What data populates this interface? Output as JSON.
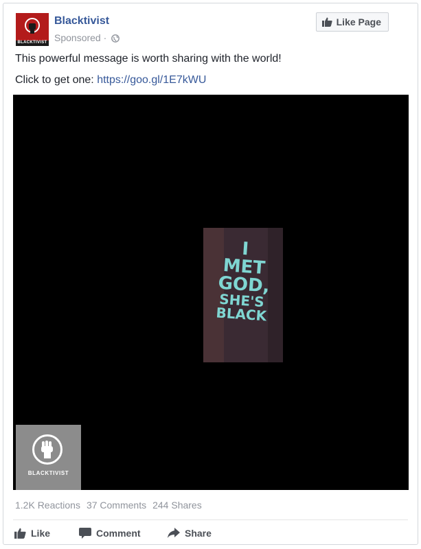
{
  "header": {
    "page_name": "Blacktivist",
    "sponsored": "Sponsored ·",
    "avatar_label": "BLACKTIVIST",
    "like_page_label": "Like Page"
  },
  "post": {
    "message": "This powerful message is worth sharing with the world!",
    "cta_prefix": "Click to get one:",
    "cta_link": "https://goo.gl/1E7kWU"
  },
  "media": {
    "shirt_lines": [
      "I",
      "MET",
      "GOD,",
      "SHE'S",
      "BLACK"
    ],
    "watermark_label": "BLACKTIVIST"
  },
  "stats": {
    "reactions": "1.2K Reactions",
    "comments": "37 Comments",
    "shares": "244 Shares"
  },
  "actions": {
    "like": "Like",
    "comment": "Comment",
    "share": "Share"
  },
  "colors": {
    "link": "#365899",
    "muted": "#90949c",
    "shirt_text": "#7fd6d2"
  }
}
